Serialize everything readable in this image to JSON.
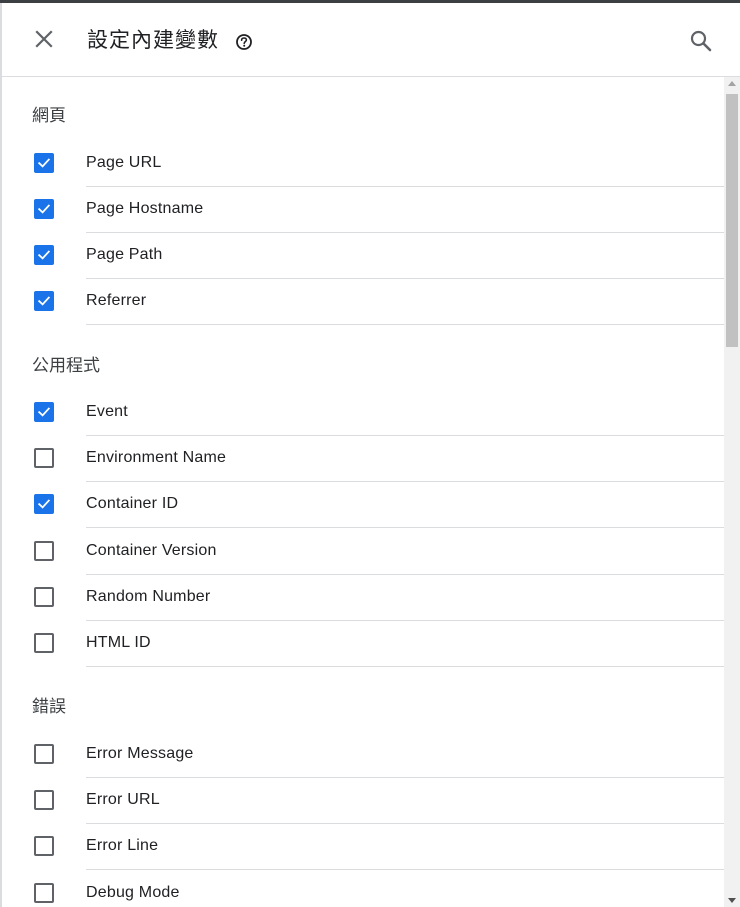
{
  "header": {
    "title": "設定內建變數",
    "close_icon": "close-icon",
    "help_icon": "help-circle-icon",
    "search_icon": "search-icon"
  },
  "colors": {
    "checked": "#1a73e8",
    "unchecked_border": "#5f6368",
    "divider": "#dadce0"
  },
  "sections": [
    {
      "title": "網頁",
      "items": [
        {
          "label": "Page URL",
          "checked": true
        },
        {
          "label": "Page Hostname",
          "checked": true
        },
        {
          "label": "Page Path",
          "checked": true
        },
        {
          "label": "Referrer",
          "checked": true
        }
      ]
    },
    {
      "title": "公用程式",
      "items": [
        {
          "label": "Event",
          "checked": true
        },
        {
          "label": "Environment Name",
          "checked": false
        },
        {
          "label": "Container ID",
          "checked": true
        },
        {
          "label": "Container Version",
          "checked": false
        },
        {
          "label": "Random Number",
          "checked": false
        },
        {
          "label": "HTML ID",
          "checked": false
        }
      ]
    },
    {
      "title": "錯誤",
      "items": [
        {
          "label": "Error Message",
          "checked": false
        },
        {
          "label": "Error URL",
          "checked": false
        },
        {
          "label": "Error Line",
          "checked": false
        },
        {
          "label": "Debug Mode",
          "checked": false
        }
      ]
    }
  ]
}
